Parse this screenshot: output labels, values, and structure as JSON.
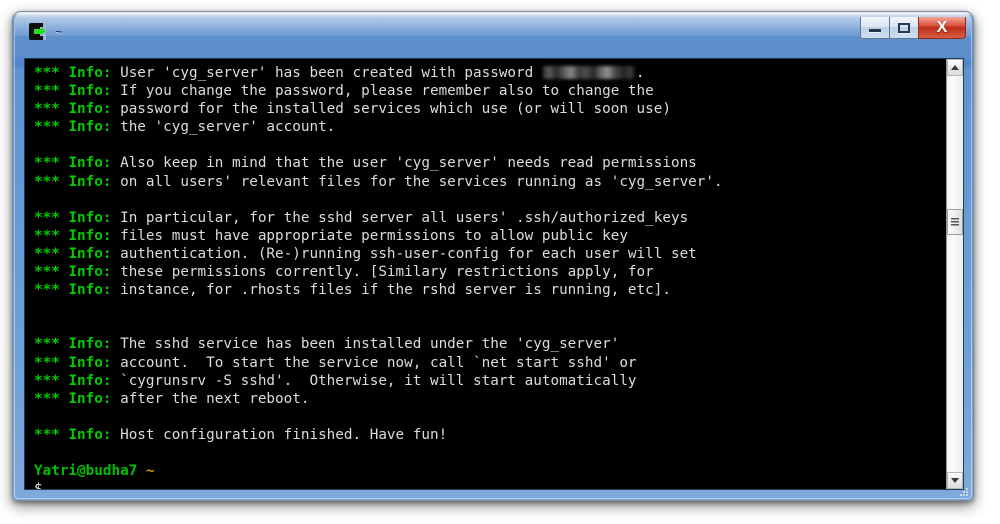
{
  "window": {
    "title": "~",
    "icon": "cygwin-terminal-icon",
    "buttons": {
      "minimize_label": "–",
      "maximize_label": "□",
      "close_label": "X"
    },
    "frame_color": "#5d8fcd",
    "close_color": "#bd2d19"
  },
  "terminal": {
    "background": "#000000",
    "foreground": "#dcdcdc",
    "accent_green": "#00cc00",
    "prompt_tilde_color": "#c8a000",
    "prefix_stars": "***",
    "prefix_label": "Info:",
    "lines": [
      {
        "type": "info",
        "msg_pre": "User 'cyg_server' has been created with password ",
        "redacted": true,
        "msg_post": "."
      },
      {
        "type": "info",
        "msg": "If you change the password, please remember also to change the"
      },
      {
        "type": "info",
        "msg": "password for the installed services which use (or will soon use)"
      },
      {
        "type": "info",
        "msg": "the 'cyg_server' account."
      },
      {
        "type": "blank",
        "msg": ""
      },
      {
        "type": "info",
        "msg": "Also keep in mind that the user 'cyg_server' needs read permissions"
      },
      {
        "type": "info",
        "msg": "on all users' relevant files for the services running as 'cyg_server'."
      },
      {
        "type": "blank",
        "msg": ""
      },
      {
        "type": "info",
        "msg": "In particular, for the sshd server all users' .ssh/authorized_keys"
      },
      {
        "type": "info",
        "msg": "files must have appropriate permissions to allow public key"
      },
      {
        "type": "info",
        "msg": "authentication. (Re-)running ssh-user-config for each user will set"
      },
      {
        "type": "info",
        "msg": "these permissions corrently. [Similary restrictions apply, for"
      },
      {
        "type": "info",
        "msg": "instance, for .rhosts files if the rshd server is running, etc]."
      },
      {
        "type": "blank",
        "msg": ""
      },
      {
        "type": "blank",
        "msg": ""
      },
      {
        "type": "info",
        "msg": "The sshd service has been installed under the 'cyg_server'"
      },
      {
        "type": "info",
        "msg": "account.  To start the service now, call `net start sshd' or"
      },
      {
        "type": "info",
        "msg": "`cygrunsrv -S sshd'.  Otherwise, it will start automatically"
      },
      {
        "type": "info",
        "msg": "after the next reboot."
      },
      {
        "type": "blank",
        "msg": ""
      },
      {
        "type": "info",
        "msg": "Host configuration finished. Have fun!"
      },
      {
        "type": "blank",
        "msg": ""
      },
      {
        "type": "prompt",
        "host": "Yatri@budha7",
        "path": "~"
      },
      {
        "type": "cursorline",
        "symbol": "$"
      }
    ]
  },
  "scrollbar": {
    "up_arrow": "▲",
    "down_arrow": "▼",
    "thumb_grip": "grip-lines"
  }
}
